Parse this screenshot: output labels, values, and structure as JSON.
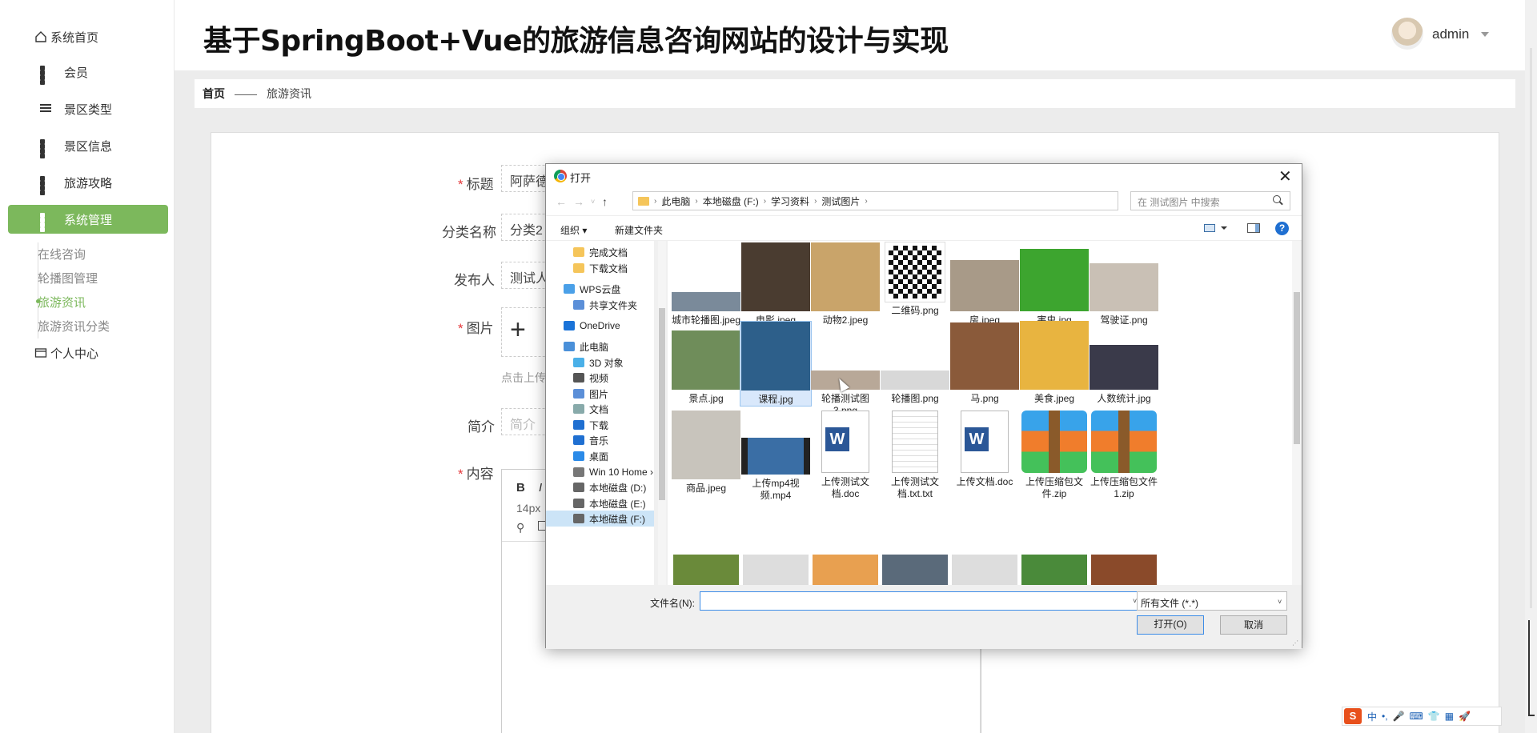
{
  "app": {
    "title": "基于SpringBoot+Vue的旅游信息咨询网站的设计与实现",
    "user": "admin"
  },
  "sidebar": {
    "home": "系统首页",
    "items": [
      "会员",
      "景区类型",
      "景区信息",
      "旅游攻略",
      "系统管理"
    ],
    "submenu": [
      "在线咨询",
      "轮播图管理",
      "旅游资讯",
      "旅游资讯分类"
    ],
    "personal": "个人中心",
    "accent_color": "#7cb85c"
  },
  "breadcrumb": {
    "home": "首页",
    "sep": "——",
    "current": "旅游资讯"
  },
  "form": {
    "title_label": "标题",
    "title_value": "阿萨德",
    "category_label": "分类名称",
    "category_value": "分类2",
    "publisher_label": "发布人",
    "publisher_value": "测试人",
    "image_label": "图片",
    "upload_plus": "+",
    "upload_tip": "点击上传",
    "intro_label": "简介",
    "intro_placeholder": "简介",
    "content_label": "内容",
    "editor_bold": "B",
    "editor_italic": "I",
    "editor_font_size": "14px",
    "editor_link_icon": "⚲"
  },
  "dialog": {
    "title": "打开",
    "close": "✕",
    "path": [
      "此电脑",
      "本地磁盘 (F:)",
      "学习资料",
      "测试图片"
    ],
    "search_placeholder": "在 测试图片 中搜索",
    "toolbar": {
      "organize": "组织 ▾",
      "new_folder": "新建文件夹",
      "help": "?"
    },
    "nav_items": [
      "完成文档",
      "下载文档",
      "WPS云盘",
      "共享文件夹",
      "OneDrive",
      "此电脑",
      "3D 对象",
      "视频",
      "图片",
      "文档",
      "下载",
      "音乐",
      "桌面",
      "Win 10 Home ›",
      "本地磁盘 (D:)",
      "本地磁盘 (E:)",
      "本地磁盘 (F:)"
    ],
    "files": [
      {
        "name": "城市轮播图.jpeg",
        "icon": "image-thumb",
        "color": "#7a8a9a"
      },
      {
        "name": "电影.jpeg",
        "icon": "image-thumb",
        "color": "#4a3c30"
      },
      {
        "name": "动物2.jpeg",
        "icon": "image-thumb",
        "color": "#c9a46a"
      },
      {
        "name": "二维码.png",
        "icon": "qr-thumb",
        "color": "#111111"
      },
      {
        "name": "房.jpeg",
        "icon": "image-thumb",
        "color": "#a89a88"
      },
      {
        "name": "害虫.jpg",
        "icon": "image-thumb",
        "color": "#3da52f"
      },
      {
        "name": "驾驶证.png",
        "icon": "image-thumb",
        "color": "#c9c0b5"
      },
      {
        "name": "景点.jpg",
        "icon": "image-thumb",
        "color": "#6f8d5a"
      },
      {
        "name": "课程.jpg",
        "icon": "image-thumb",
        "color": "#2d5f8a"
      },
      {
        "name": "轮播测试图3.png",
        "icon": "image-thumb",
        "color": "#b8a898"
      },
      {
        "name": "轮播图.png",
        "icon": "image-thumb",
        "color": "#d8d8d8"
      },
      {
        "name": "马.png",
        "icon": "image-thumb",
        "color": "#8a5a3a"
      },
      {
        "name": "美食.jpeg",
        "icon": "image-thumb",
        "color": "#e8b440"
      },
      {
        "name": "人数统计.jpg",
        "icon": "image-thumb",
        "color": "#3a3a4a"
      },
      {
        "name": "商品.jpeg",
        "icon": "image-thumb",
        "color": "#c8c4bc"
      },
      {
        "name": "上传mp4视频.mp4",
        "icon": "video-thumb",
        "color": "#3a6ea5"
      },
      {
        "name": "上传测试文档.doc",
        "icon": "word-icon",
        "color": "#2b5797"
      },
      {
        "name": "上传测试文档.txt.txt",
        "icon": "text-file-icon",
        "color": "#ffffff"
      },
      {
        "name": "上传文档.doc",
        "icon": "word-icon",
        "color": "#2b5797"
      },
      {
        "name": "上传压缩包文件.zip",
        "icon": "zip-icon",
        "color": "#3aa0e8"
      },
      {
        "name": "上传压缩包文件1.zip",
        "icon": "zip-icon",
        "color": "#3aa0e8"
      }
    ],
    "filename_label": "文件名(N):",
    "filename_value": "",
    "filetype": "所有文件 (*.*)",
    "open_button": "打开(O)",
    "cancel_button": "取消"
  },
  "ime": {
    "logo": "S",
    "items": [
      "中",
      "•,",
      "🎤",
      "⌨",
      "👕",
      "▦",
      "🚀"
    ]
  }
}
